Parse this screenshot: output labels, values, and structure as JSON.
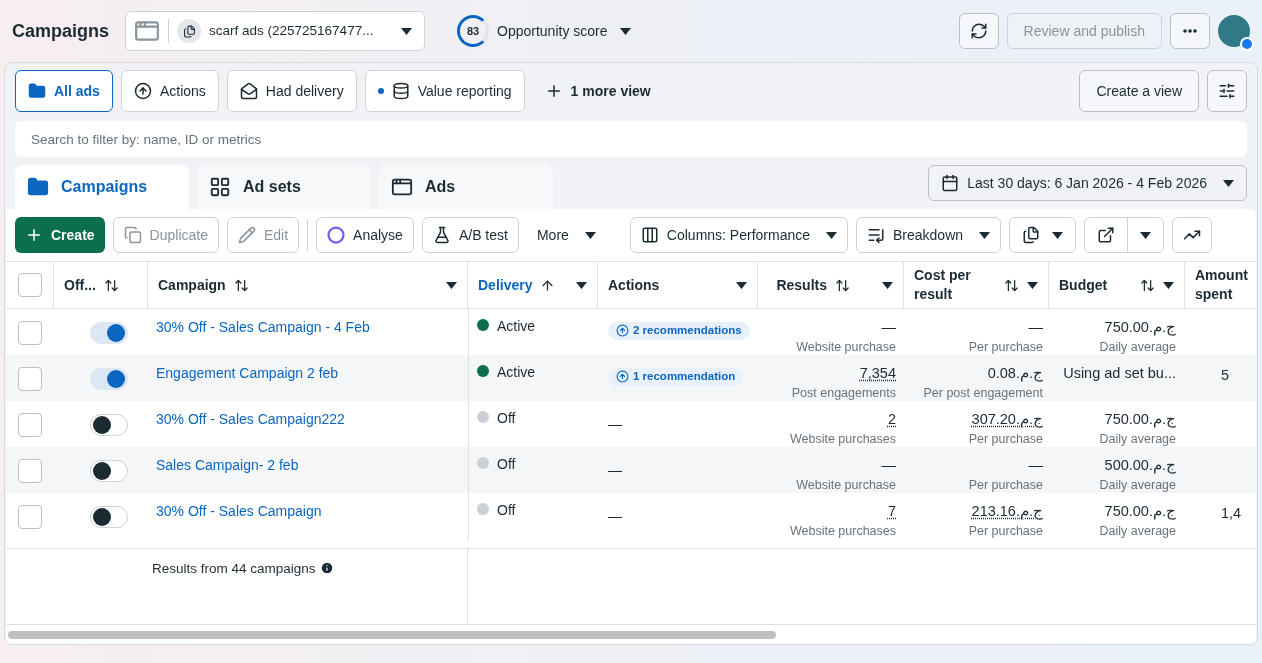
{
  "header": {
    "title": "Campaigns",
    "account": "scarf ads (225725167477...",
    "score": "83",
    "score_label": "Opportunity score",
    "review_button": {
      "label": "Review and publish",
      "disabled": true
    }
  },
  "views": [
    {
      "label": "All ads",
      "selected": true,
      "kind": "folder"
    },
    {
      "label": "Actions",
      "selected": false,
      "kind": "actions"
    },
    {
      "label": "Had delivery",
      "selected": false,
      "kind": "mail"
    },
    {
      "label": "Value reporting",
      "selected": false,
      "kind": "coins",
      "dot": true
    }
  ],
  "more_views": "1 more view",
  "create_view": "Create a view",
  "search": {
    "placeholder": "Search to filter by: name, ID or metrics"
  },
  "level_tabs": [
    {
      "label": "Campaigns",
      "selected": true,
      "kind": "campaigns"
    },
    {
      "label": "Ad sets",
      "selected": false,
      "kind": "adsets"
    },
    {
      "label": "Ads",
      "selected": false,
      "kind": "ads"
    }
  ],
  "date_range": "Last 30 days: 6 Jan 2026 - 4 Feb 2026",
  "toolbar": [
    {
      "label": "Create",
      "kind": "create"
    },
    {
      "label": "Duplicate",
      "kind": "duplicate",
      "disabled": true
    },
    {
      "label": "Edit",
      "kind": "edit",
      "disabled": true
    },
    {
      "label": "Analyse",
      "kind": "analyse",
      "disabled": false
    },
    {
      "label": "A/B test",
      "kind": "abtest",
      "disabled": false
    },
    {
      "label": "More",
      "kind": "more"
    },
    {
      "label": "Columns: Performance",
      "kind": "columns"
    },
    {
      "label": "Breakdown",
      "kind": "breakdown"
    }
  ],
  "table": {
    "select_all": {
      "checked": false
    },
    "columns": [
      {
        "label": "Off...",
        "sortable": true,
        "menu": false,
        "active": false
      },
      {
        "label": "Campaign",
        "sortable": true,
        "menu": true,
        "active": false
      },
      {
        "label": "Delivery",
        "sortable": true,
        "menu": true,
        "active": true
      },
      {
        "label": "Actions",
        "sortable": false,
        "menu": true,
        "active": false
      },
      {
        "label": "Results",
        "sortable": true,
        "menu": true,
        "active": false
      },
      {
        "label": "Cost per result",
        "sortable": true,
        "menu": true,
        "active": false
      },
      {
        "label": "Budget",
        "sortable": true,
        "menu": true,
        "active": false
      },
      {
        "label": "Amount spent",
        "sortable": false,
        "menu": false,
        "active": false
      }
    ],
    "rows": [
      {
        "checked": false,
        "on": true,
        "name": "30% Off - Sales Campaign - 4 Feb",
        "delivery": "Active",
        "color": "#0a6e4f",
        "actions": "2 recommendations",
        "results": {
          "value": "—",
          "sub": "Website purchase",
          "dotted": false
        },
        "cost": {
          "value": "—",
          "sub": "Per purchase",
          "dotted": false
        },
        "budget": {
          "value": "ج.م.750.00",
          "sub": "Daily average"
        }
      },
      {
        "checked": false,
        "on": true,
        "name": "Engagement Campaign 2 feb",
        "delivery": "Active",
        "color": "#0a6e4f",
        "actions": "1 recommendation",
        "results": {
          "value": "7,354",
          "sub": "Post engagements",
          "dotted": true
        },
        "cost": {
          "value": "ج.م.0.08",
          "sub": "Per post engagement",
          "dotted": false
        },
        "budget": {
          "value": "Using ad set bu..."
        },
        "spent": "5"
      },
      {
        "checked": false,
        "on": false,
        "name": "30% Off - Sales Campaign222",
        "delivery": "Off",
        "color": "#cbd0d6",
        "actions_dash": "—",
        "results": {
          "value": "2",
          "sub": "Website purchases",
          "dotted": true
        },
        "cost": {
          "value": "ج.م.307.20",
          "sub": "Per purchase",
          "dotted": true
        },
        "budget": {
          "value": "ج.م.750.00",
          "sub": "Daily average"
        }
      },
      {
        "checked": false,
        "on": false,
        "name": "Sales Campaign- 2 feb",
        "delivery": "Off",
        "color": "#cbd0d6",
        "actions_dash": "—",
        "results": {
          "value": "—",
          "sub": "Website purchase",
          "dotted": false
        },
        "cost": {
          "value": "—",
          "sub": "Per purchase",
          "dotted": false
        },
        "budget": {
          "value": "ج.م.500.00",
          "sub": "Daily average"
        }
      },
      {
        "checked": false,
        "on": false,
        "name": "30% Off - Sales Campaign",
        "delivery": "Off",
        "color": "#cbd0d6",
        "actions_dash": "—",
        "results": {
          "value": "7",
          "sub": "Website purchases",
          "dotted": true
        },
        "cost": {
          "value": "ج.م.213.16",
          "sub": "Per purchase",
          "dotted": true
        },
        "budget": {
          "value": "ج.م.750.00",
          "sub": "Daily average"
        },
        "spent": "1,4"
      }
    ]
  },
  "footer": "Results from 44 campaigns"
}
